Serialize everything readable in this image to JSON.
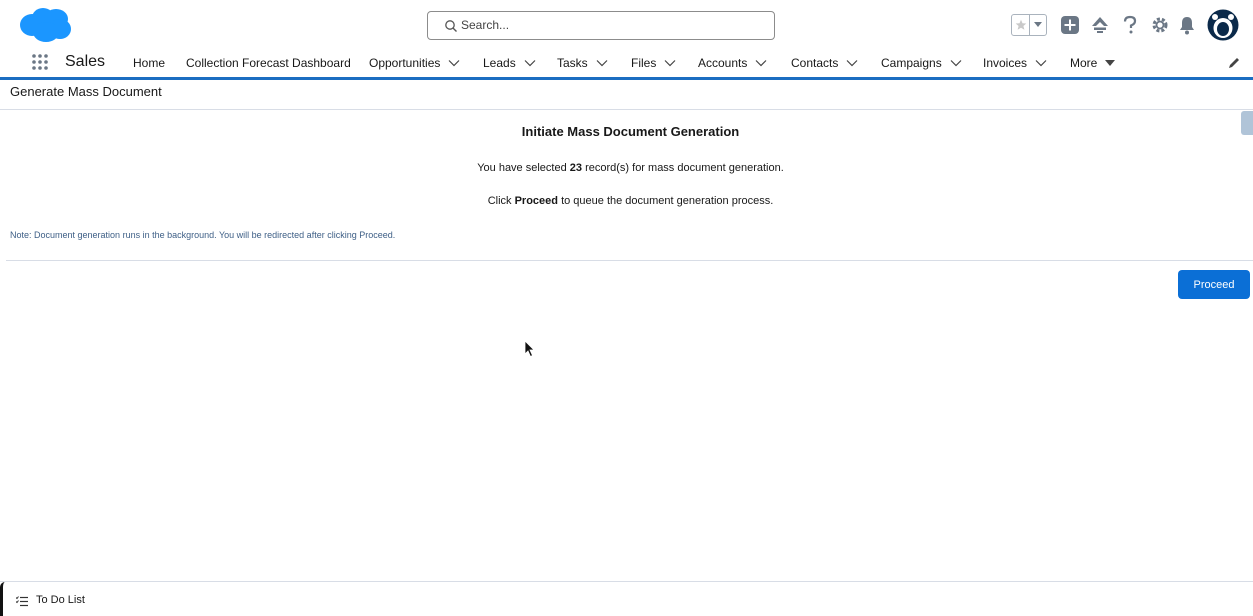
{
  "header": {
    "search_placeholder": "Search...",
    "brand_color": "#1b96ff"
  },
  "nav": {
    "app_name": "Sales",
    "items": [
      {
        "label": "Home",
        "has_menu": false
      },
      {
        "label": "Collection Forecast Dashboard",
        "has_menu": false
      },
      {
        "label": "Opportunities",
        "has_menu": true
      },
      {
        "label": "Leads",
        "has_menu": true
      },
      {
        "label": "Tasks",
        "has_menu": true
      },
      {
        "label": "Files",
        "has_menu": true
      },
      {
        "label": "Accounts",
        "has_menu": true
      },
      {
        "label": "Contacts",
        "has_menu": true
      },
      {
        "label": "Campaigns",
        "has_menu": true
      },
      {
        "label": "Invoices",
        "has_menu": true
      },
      {
        "label": "More",
        "has_menu": true
      }
    ]
  },
  "page": {
    "title": "Generate Mass Document"
  },
  "content": {
    "heading": "Initiate Mass Document Generation",
    "selected_prefix": "You have selected ",
    "selected_count": "23",
    "selected_suffix": " record(s) for mass document generation.",
    "click_prefix": "Click ",
    "click_bold": "Proceed",
    "click_suffix": " to queue the document generation process.",
    "note": "Note: Document generation runs in the background. You will be redirected after clicking Proceed.",
    "proceed_label": "Proceed"
  },
  "footer": {
    "todo_label": "To Do List"
  }
}
